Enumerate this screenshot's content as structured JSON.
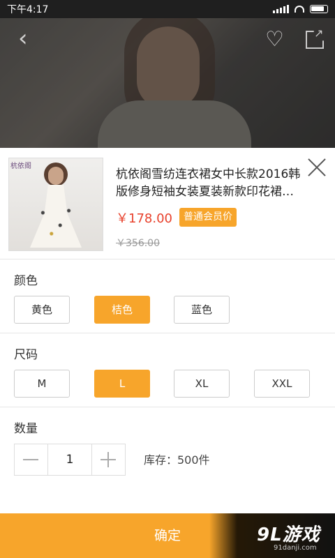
{
  "status_bar": {
    "time": "下午4:17"
  },
  "hero": {
    "back_icon": "chevron-left-icon",
    "fav_icon": "heart-icon",
    "share_icon": "share-icon"
  },
  "product": {
    "title": "杭依阁雪纺连衣裙女中长款2016韩版修身短袖女装夏装新款印花裙…",
    "price": "￥178.00",
    "badge": "普通会员价",
    "original_price": "￥356.00",
    "thumb_logo": "杭依阁"
  },
  "color": {
    "title": "颜色",
    "options": [
      "黄色",
      "桔色",
      "蓝色"
    ],
    "selected": "桔色"
  },
  "size": {
    "title": "尺码",
    "options": [
      "M",
      "L",
      "XL",
      "XXL"
    ],
    "selected": "L"
  },
  "quantity": {
    "title": "数量",
    "value": "1",
    "stock": "库存：500件"
  },
  "confirm_label": "确定",
  "watermark": {
    "text": "9L游戏",
    "sub": "91danji.com"
  },
  "colors": {
    "accent": "#f7a52b",
    "price": "#e8412c"
  }
}
